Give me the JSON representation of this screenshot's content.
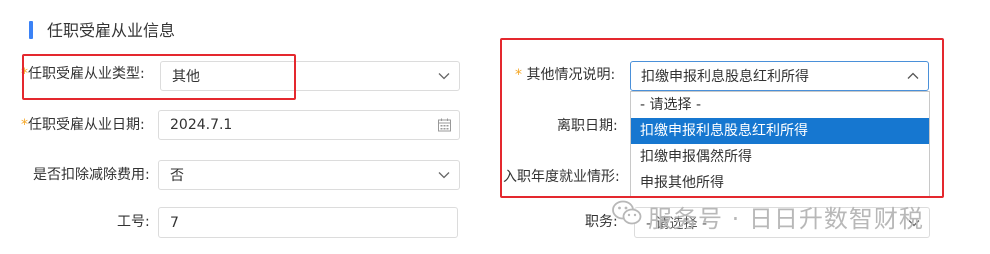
{
  "section": {
    "title": "任职受雇从业信息"
  },
  "left": {
    "employment_type": {
      "label": "任职受雇从业类型:",
      "value": "其他",
      "required": "*"
    },
    "employment_date": {
      "label": "任职受雇从业日期:",
      "value": "2024.7.1",
      "required": "*"
    },
    "deduct_fee": {
      "label": "是否扣除减除费用:",
      "value": "否"
    },
    "employee_no": {
      "label": "工号:",
      "value": "7"
    }
  },
  "right": {
    "other_situation": {
      "label": "其他情况说明:",
      "value": "扣缴申报利息股息红利所得",
      "required": "*"
    },
    "leave_date": {
      "label": "离职日期:"
    },
    "entry_year": {
      "label": "入职年度就业情形:"
    },
    "position": {
      "label": "职务:",
      "placeholder": "- 请选择 -"
    }
  },
  "dropdown": {
    "options": [
      {
        "label": "- 请选择 -"
      },
      {
        "label": "扣缴申报利息股息红利所得"
      },
      {
        "label": "扣缴申报偶然所得"
      },
      {
        "label": "申报其他所得"
      }
    ],
    "selected_index": 1
  },
  "watermark": {
    "text": "服务号 · 日日升数智财税"
  },
  "colors": {
    "accent": "#3b82f6",
    "highlight": "#e4282e",
    "selected": "#1677d0",
    "required": "#f5a623"
  },
  "icons": {
    "select_arrow": "chevron-down-icon",
    "open_arrow": "chevron-up-icon",
    "date": "calendar-icon",
    "watermark": "wechat-icon"
  }
}
